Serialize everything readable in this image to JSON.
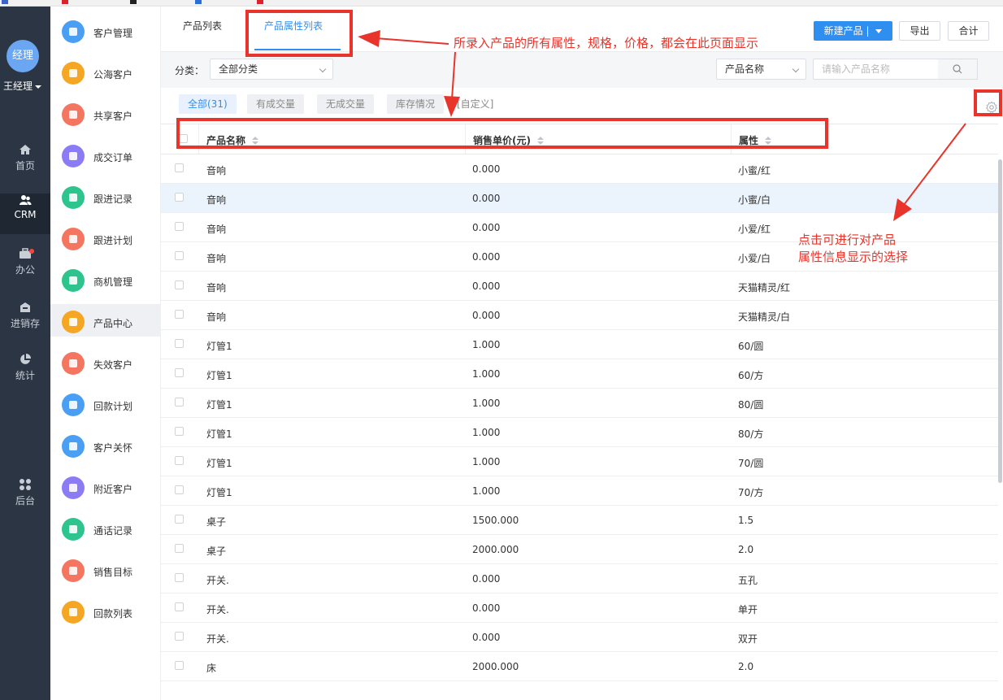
{
  "nav": {
    "avatar_text": "经理",
    "user_name": "王经理",
    "items": [
      {
        "label": "首页",
        "icon": "home-icon"
      },
      {
        "label": "CRM",
        "icon": "people-icon"
      },
      {
        "label": "办公",
        "icon": "briefcase-icon"
      },
      {
        "label": "进销存",
        "icon": "inventory-icon"
      },
      {
        "label": "统计",
        "icon": "pie-chart-icon"
      },
      {
        "label": "后台",
        "icon": "grid-icon"
      }
    ]
  },
  "submenu": {
    "items": [
      {
        "label": "客户管理",
        "color": "#4a9ff5"
      },
      {
        "label": "公海客户",
        "color": "#f5a623"
      },
      {
        "label": "共享客户",
        "color": "#f47560"
      },
      {
        "label": "成交订单",
        "color": "#8b7cf6"
      },
      {
        "label": "跟进记录",
        "color": "#2ec48e"
      },
      {
        "label": "跟进计划",
        "color": "#f47560"
      },
      {
        "label": "商机管理",
        "color": "#2ec48e"
      },
      {
        "label": "产品中心",
        "color": "#f5a623"
      },
      {
        "label": "失效客户",
        "color": "#f47560"
      },
      {
        "label": "回款计划",
        "color": "#4a9ff5"
      },
      {
        "label": "客户关怀",
        "color": "#4a9ff5"
      },
      {
        "label": "附近客户",
        "color": "#8b7cf6"
      },
      {
        "label": "通话记录",
        "color": "#2ec48e"
      },
      {
        "label": "销售目标",
        "color": "#f47560"
      },
      {
        "label": "回款列表",
        "color": "#f5a623"
      }
    ]
  },
  "tabs": [
    "产品列表",
    "产品属性列表"
  ],
  "toolbar": {
    "new_label": "新建产品 |",
    "export_label": "导出",
    "sum_label": "合计"
  },
  "filter": {
    "category_label": "分类：",
    "category_value": "全部分类",
    "field_value": "产品名称",
    "search_placeholder": "请输入产品名称"
  },
  "chips": [
    "全部(31)",
    "有成交量",
    "无成交量",
    "库存情况",
    "[自定义]"
  ],
  "table": {
    "columns": [
      "产品名称",
      "销售单价(元)",
      "属性"
    ],
    "rows": [
      [
        "音响",
        "0.000",
        "小蜜/红"
      ],
      [
        "音响",
        "0.000",
        "小蜜/白"
      ],
      [
        "音响",
        "0.000",
        "小爱/红"
      ],
      [
        "音响",
        "0.000",
        "小爱/白"
      ],
      [
        "音响",
        "0.000",
        "天猫精灵/红"
      ],
      [
        "音响",
        "0.000",
        "天猫精灵/白"
      ],
      [
        "灯管1",
        "1.000",
        "60/圆"
      ],
      [
        "灯管1",
        "1.000",
        "60/方"
      ],
      [
        "灯管1",
        "1.000",
        "80/圆"
      ],
      [
        "灯管1",
        "1.000",
        "80/方"
      ],
      [
        "灯管1",
        "1.000",
        "70/圆"
      ],
      [
        "灯管1",
        "1.000",
        "70/方"
      ],
      [
        "桌子",
        "1500.000",
        "1.5"
      ],
      [
        "桌子",
        "2000.000",
        "2.0"
      ],
      [
        "开关.",
        "0.000",
        "五孔"
      ],
      [
        "开关.",
        "0.000",
        "单开"
      ],
      [
        "开关.",
        "0.000",
        "双开"
      ],
      [
        "床",
        "2000.000",
        "2.0"
      ]
    ]
  },
  "annotations": {
    "top": "所录入产品的所有属性，规格，价格，都会在此页面显示",
    "right_line1": "点击可进行对产品",
    "right_line2": "属性信息显示的选择"
  }
}
